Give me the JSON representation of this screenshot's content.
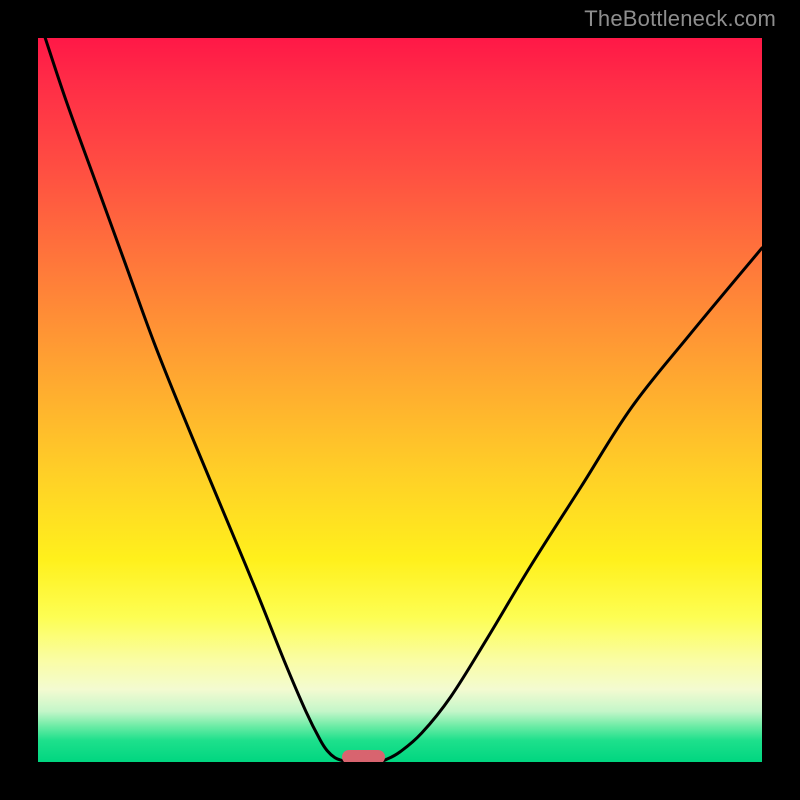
{
  "watermark": "TheBottleneck.com",
  "chart_data": {
    "type": "line",
    "title": "",
    "xlabel": "",
    "ylabel": "",
    "xlim": [
      0,
      100
    ],
    "ylim": [
      0,
      100
    ],
    "grid": false,
    "legend": false,
    "series": [
      {
        "name": "left-curve",
        "x": [
          1,
          4,
          8,
          12,
          16,
          20,
          25,
          30,
          34,
          37,
          39,
          40,
          41,
          42,
          43
        ],
        "y": [
          100,
          91,
          80,
          69,
          58,
          48,
          36,
          24,
          14,
          7,
          3,
          1.5,
          0.6,
          0.2,
          0
        ]
      },
      {
        "name": "right-curve",
        "x": [
          47,
          48,
          50,
          53,
          57,
          62,
          68,
          75,
          82,
          90,
          100
        ],
        "y": [
          0,
          0.3,
          1.4,
          4,
          9,
          17,
          27,
          38,
          49,
          59,
          71
        ]
      }
    ],
    "marker": {
      "name": "optimal-range",
      "x_center": 45,
      "width": 6,
      "y": 0,
      "color": "#d8646f"
    },
    "background": {
      "type": "vertical-gradient",
      "stops": [
        {
          "pos": 0.0,
          "color": "#ff1847"
        },
        {
          "pos": 0.18,
          "color": "#ff4e42"
        },
        {
          "pos": 0.46,
          "color": "#ffa531"
        },
        {
          "pos": 0.72,
          "color": "#fff01c"
        },
        {
          "pos": 0.9,
          "color": "#f3fbd1"
        },
        {
          "pos": 1.0,
          "color": "#00d680"
        }
      ]
    }
  }
}
